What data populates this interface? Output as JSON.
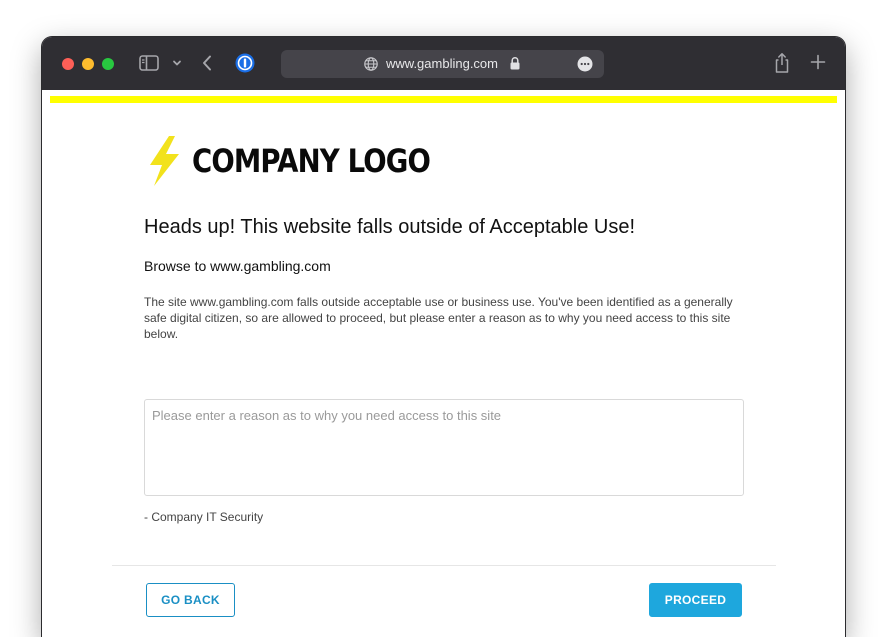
{
  "browser": {
    "url": "www.gambling.com",
    "icons": [
      "sidebar-icon",
      "chevron-down-icon",
      "back-icon",
      "password-manager-icon",
      "globe-icon",
      "lock-icon",
      "more-icon",
      "share-icon",
      "plus-icon"
    ]
  },
  "page": {
    "accent_color": "#ffff00",
    "logo_text": "COMPANY LOGO",
    "logo_icon": "lightning-bolt-icon",
    "heading": "Heads up! This website falls outside of Acceptable Use!",
    "browse_line": "Browse to www.gambling.com",
    "description": "The site www.gambling.com falls outside acceptable use or business use. You've been identified as a generally safe digital citizen, so are allowed to proceed, but please enter a reason as to why you need access to this site below.",
    "reason_placeholder": "Please enter a reason as to why you need access to this site",
    "reason_value": "",
    "signature": "- Company IT Security",
    "buttons": {
      "go_back": "GO BACK",
      "proceed": "PROCEED"
    },
    "button_color": "#1ea7dd"
  }
}
